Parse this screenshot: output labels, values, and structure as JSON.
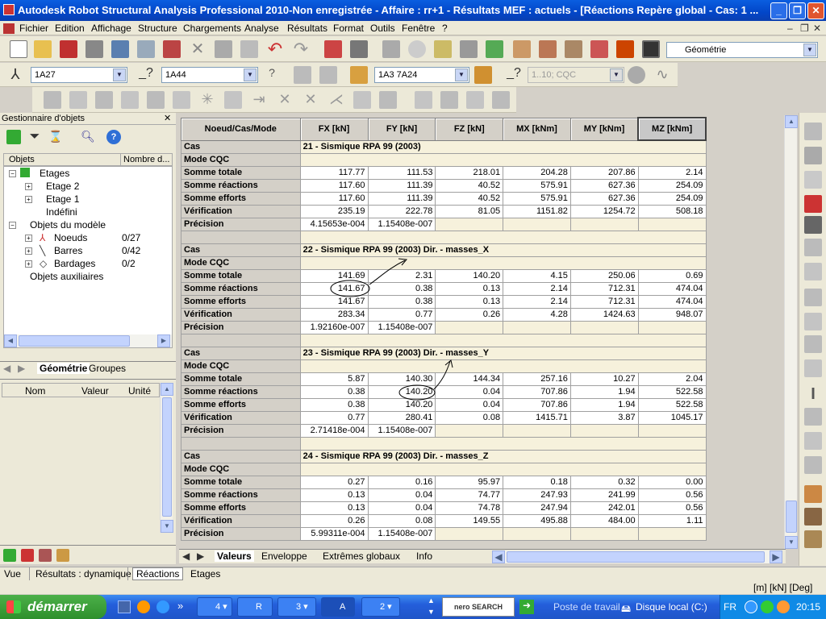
{
  "window": {
    "title": "Autodesk Robot Structural Analysis Professional 2010-Non enregistrée - Affaire : rr+1 - Résultats MEF : actuels - [Réactions Repère global - Cas:  1 ..."
  },
  "menu": [
    "Fichier",
    "Edition",
    "Affichage",
    "Structure",
    "Chargements",
    "Analyse",
    "Résultats",
    "Format",
    "Outils",
    "Fenêtre",
    "?"
  ],
  "toolbar": {
    "view_combo": "Géométrie",
    "node_combo": "1A27",
    "bar_combo": "1A44",
    "case_combo": "1A3 7A24",
    "mode_combo": "1..10; CQC"
  },
  "object_manager": {
    "title": "Gestionnaire d'objets",
    "col_objects": "Objets",
    "col_count": "Nombre d...",
    "tree": [
      {
        "label": "Etages",
        "count": ""
      },
      {
        "label": "Etage 2",
        "count": ""
      },
      {
        "label": "Etage 1",
        "count": ""
      },
      {
        "label": "Indéfini",
        "count": ""
      },
      {
        "label": "Objets du modèle",
        "count": ""
      },
      {
        "label": "Noeuds",
        "count": "0/27"
      },
      {
        "label": "Barres",
        "count": "0/42"
      },
      {
        "label": "Bardages",
        "count": "0/2"
      },
      {
        "label": "Objets auxiliaires",
        "count": ""
      }
    ],
    "tab_geometry": "Géométrie",
    "tab_groups": "Groupes",
    "prop_name": "Nom",
    "prop_value": "Valeur",
    "prop_unit": "Unité"
  },
  "results": {
    "headers": [
      "Noeud/Cas/Mode",
      "FX [kN]",
      "FY [kN]",
      "FZ [kN]",
      "MX [kNm]",
      "MY [kNm]",
      "MZ [kNm]"
    ],
    "blocks": [
      {
        "case": "21 - Sismique RPA 99 (2003)",
        "rows": [
          {
            "label": "Somme totale",
            "values": [
              "117.77",
              "111.53",
              "218.01",
              "204.28",
              "207.86",
              "2.14"
            ]
          },
          {
            "label": "Somme réactions",
            "values": [
              "117.60",
              "111.39",
              "40.52",
              "575.91",
              "627.36",
              "254.09"
            ]
          },
          {
            "label": "Somme efforts",
            "values": [
              "117.60",
              "111.39",
              "40.52",
              "575.91",
              "627.36",
              "254.09"
            ]
          },
          {
            "label": "Vérification",
            "values": [
              "235.19",
              "222.78",
              "81.05",
              "1151.82",
              "1254.72",
              "508.18"
            ]
          },
          {
            "label": "Précision",
            "values": [
              "4.15653e-004",
              "1.15408e-007",
              "",
              "",
              "",
              ""
            ]
          }
        ]
      },
      {
        "case": "22 - Sismique RPA 99 (2003) Dir. - masses_X",
        "rows": [
          {
            "label": "Somme totale",
            "values": [
              "141.69",
              "2.31",
              "140.20",
              "4.15",
              "250.06",
              "0.69"
            ]
          },
          {
            "label": "Somme réactions",
            "values": [
              "141.67",
              "0.38",
              "0.13",
              "2.14",
              "712.31",
              "474.04"
            ]
          },
          {
            "label": "Somme efforts",
            "values": [
              "141.67",
              "0.38",
              "0.13",
              "2.14",
              "712.31",
              "474.04"
            ]
          },
          {
            "label": "Vérification",
            "values": [
              "283.34",
              "0.77",
              "0.26",
              "4.28",
              "1424.63",
              "948.07"
            ]
          },
          {
            "label": "Précision",
            "values": [
              "1.92160e-007",
              "1.15408e-007",
              "",
              "",
              "",
              ""
            ]
          }
        ]
      },
      {
        "case": "23 - Sismique RPA 99 (2003) Dir. - masses_Y",
        "rows": [
          {
            "label": "Somme totale",
            "values": [
              "5.87",
              "140.30",
              "144.34",
              "257.16",
              "10.27",
              "2.04"
            ]
          },
          {
            "label": "Somme réactions",
            "values": [
              "0.38",
              "140.20",
              "0.04",
              "707.86",
              "1.94",
              "522.58"
            ]
          },
          {
            "label": "Somme efforts",
            "values": [
              "0.38",
              "140.20",
              "0.04",
              "707.86",
              "1.94",
              "522.58"
            ]
          },
          {
            "label": "Vérification",
            "values": [
              "0.77",
              "280.41",
              "0.08",
              "1415.71",
              "3.87",
              "1045.17"
            ]
          },
          {
            "label": "Précision",
            "values": [
              "2.71418e-004",
              "1.15408e-007",
              "",
              "",
              "",
              ""
            ]
          }
        ]
      },
      {
        "case": "24 - Sismique RPA 99 (2003) Dir. - masses_Z",
        "rows": [
          {
            "label": "Somme totale",
            "values": [
              "0.27",
              "0.16",
              "95.97",
              "0.18",
              "0.32",
              "0.00"
            ]
          },
          {
            "label": "Somme réactions",
            "values": [
              "0.13",
              "0.04",
              "74.77",
              "247.93",
              "241.99",
              "0.56"
            ]
          },
          {
            "label": "Somme efforts",
            "values": [
              "0.13",
              "0.04",
              "74.78",
              "247.94",
              "242.01",
              "0.56"
            ]
          },
          {
            "label": "Vérification",
            "values": [
              "0.26",
              "0.08",
              "149.55",
              "495.88",
              "484.00",
              "1.11"
            ]
          },
          {
            "label": "Précision",
            "values": [
              "5.99311e-004",
              "1.15408e-007",
              "",
              "",
              "",
              ""
            ]
          }
        ]
      }
    ],
    "case_label": "Cas",
    "mode_label": "Mode CQC",
    "tabs": [
      "Valeurs",
      "Enveloppe",
      "Extrêmes globaux",
      "Info"
    ]
  },
  "statusbar": {
    "items": [
      "Vue",
      "Résultats : dynamique",
      "Réactions",
      "Etages"
    ],
    "units": "[m] [kN] [Deg]"
  },
  "taskbar": {
    "start": "démarrer",
    "tasks": [
      "4",
      "R",
      "3",
      "A",
      "2"
    ],
    "nero": "nero SEARCH",
    "desktop": "Poste de travail",
    "disk": "Disque local (C:)",
    "lang": "FR",
    "clock": "20:15"
  }
}
